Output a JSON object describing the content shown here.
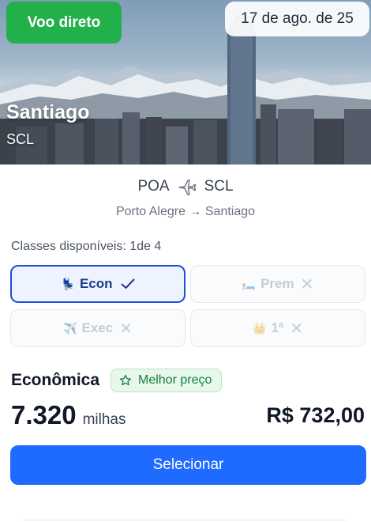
{
  "hero": {
    "badge": "Voo direto",
    "date": "17 de ago. de 25",
    "city": "Santiago",
    "code": "SCL",
    "colors": {
      "badge_bg": "#22b04b"
    }
  },
  "route": {
    "origin_code": "POA",
    "dest_code": "SCL",
    "plane_icon": "airplane-icon",
    "summary": "Porto Alegre → Santiago"
  },
  "classes": {
    "label": "Classes disponíveis: 1de 4",
    "items": [
      {
        "emoji": "💺",
        "label": "Econ",
        "available": true,
        "selected": true
      },
      {
        "emoji": "🛏️",
        "label": "Prem",
        "available": false,
        "selected": false
      },
      {
        "emoji": "✈️",
        "label": "Exec",
        "available": false,
        "selected": false
      },
      {
        "emoji": "👑",
        "label": "1ª",
        "available": false,
        "selected": false
      }
    ]
  },
  "fare": {
    "title": "Econômica",
    "badge": "Melhor preço",
    "miles": "7.320",
    "miles_unit": "milhas",
    "price": "R$ 732,00"
  },
  "action": {
    "label": "Selecionar",
    "color": "#1f6bff"
  }
}
